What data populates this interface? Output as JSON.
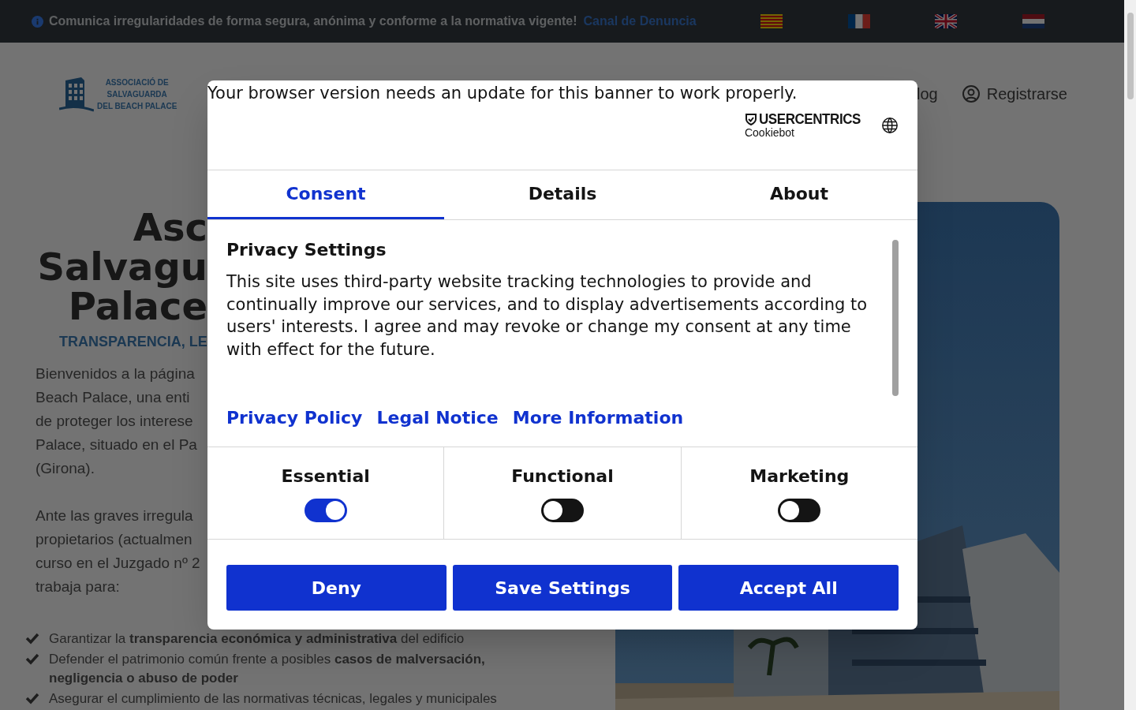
{
  "announcement": {
    "text": "Comunica irregularidades de forma segura, anónima y conforme a la normativa vigente!",
    "link": "Canal de Denuncia"
  },
  "flags": [
    {
      "kind": "catalan"
    },
    {
      "kind": "french"
    },
    {
      "kind": "british"
    },
    {
      "kind": "dutch"
    }
  ],
  "logo": {
    "lines": [
      "ASSOCIACIÓ DE",
      "SALVAGUARDA",
      "DEL BEACH PALACE"
    ]
  },
  "nav": {
    "partial_link": "log",
    "register": "Registrarse"
  },
  "hero": {
    "title_lines": [
      "Asc",
      "Salvagu",
      "Palace"
    ],
    "tagline": "TRANSPARENCIA, LE",
    "intro_lines": [
      "Bienvenidos a la página",
      "Beach Palace, una enti",
      "de proteger los interese",
      "Palace, situado en el Pa",
      "(Girona)."
    ],
    "intro2_lines": [
      "Ante las graves irregula",
      "propietarios (actualmen",
      "curso en el Juzgado nº 2",
      "trabaja para:"
    ],
    "goals": [
      {
        "text": "Garantizar la **transparencia económica y administrativa** del edificio"
      },
      {
        "text": "Defender el patrimonio común frente a posibles **casos de malversación, negligencia o abuso de poder**"
      },
      {
        "text": "Asegurar el cumplimiento de las normativas técnicas, legales y municipales"
      }
    ],
    "image": {
      "kind": "picture"
    }
  },
  "dialog": {
    "notice": "Your browser version needs an update for this banner to work properly.",
    "brand": {
      "name": "USERCENTRICS",
      "product": "Cookiebot"
    },
    "tabs": [
      {
        "label": "Consent",
        "selected": true
      },
      {
        "label": "Details",
        "selected": false
      },
      {
        "label": "About",
        "selected": false
      }
    ],
    "heading": "Privacy Settings",
    "body": "This site uses third-party website tracking technologies to provide and continually improve our services, and to display advertisements according to users' interests. I agree and may revoke or change my consent at any time with effect for the future.",
    "links": [
      "Privacy Policy",
      "Legal Notice",
      "More Information"
    ],
    "categories": [
      {
        "label": "Essential",
        "checked": true
      },
      {
        "label": "Functional",
        "checked": false
      },
      {
        "label": "Marketing",
        "checked": false
      }
    ],
    "buttons": [
      "Deny",
      "Save Settings",
      "Accept All"
    ]
  }
}
